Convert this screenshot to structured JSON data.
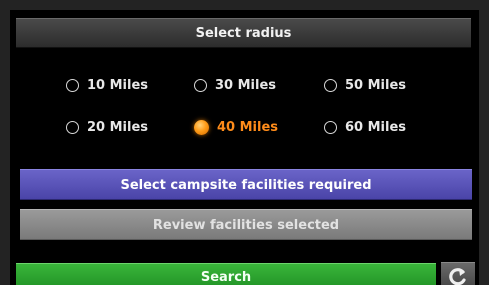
{
  "header": {
    "title": "Select radius"
  },
  "radius_options": {
    "opt_10": "10 Miles",
    "opt_30": "30 Miles",
    "opt_50": "50 Miles",
    "opt_20": "20 Miles",
    "opt_40": "40 Miles",
    "opt_60": "60 Miles",
    "selected": "40 Miles"
  },
  "buttons": {
    "facilities_label": "Select campsite facilities required",
    "review_label": "Review facilities selected",
    "search_label": "Search",
    "back_icon": "back-arrow-icon"
  },
  "colors": {
    "selected_accent": "#ff8c1a",
    "facilities_button": "#5a54b8",
    "review_button": "#8a8a8a",
    "search_button": "#2aa52f"
  }
}
